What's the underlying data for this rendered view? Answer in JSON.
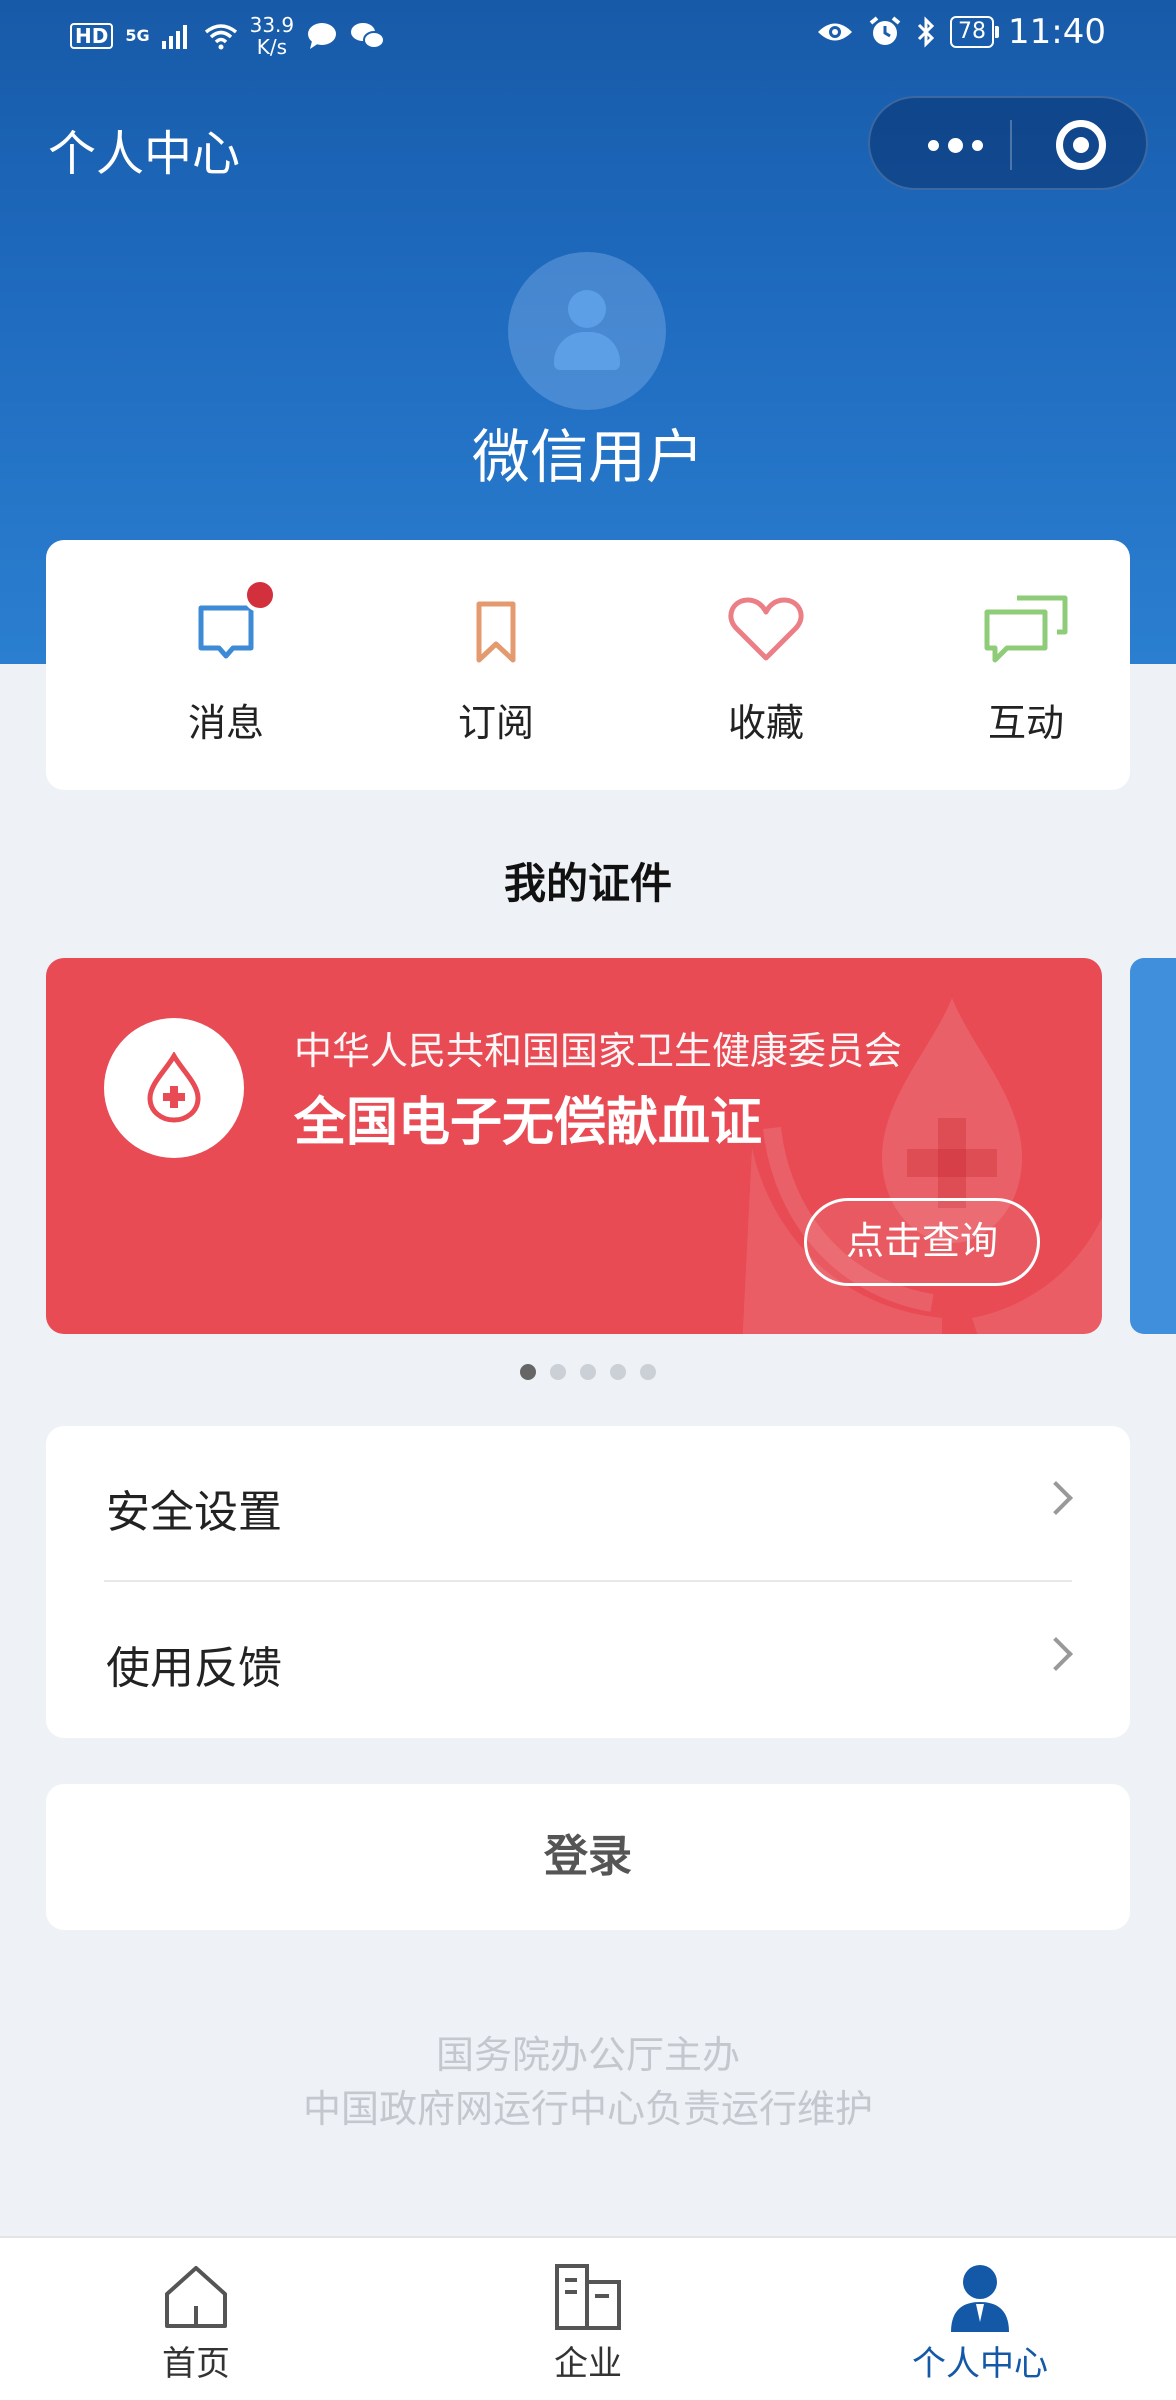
{
  "status_bar": {
    "hd": "HD",
    "network": "5G",
    "speed_value": "33.9",
    "speed_unit": "K/s",
    "battery": "78",
    "time": "11:40"
  },
  "nav": {
    "title": "个人中心"
  },
  "profile": {
    "username": "微信用户"
  },
  "quick_actions": [
    {
      "label": "消息",
      "icon": "message-icon",
      "has_badge": true
    },
    {
      "label": "订阅",
      "icon": "bookmark-icon"
    },
    {
      "label": "收藏",
      "icon": "heart-icon"
    },
    {
      "label": "互动",
      "icon": "chat-bubbles-icon"
    }
  ],
  "certificates": {
    "title": "我的证件",
    "card": {
      "org": "中华人民共和国国家卫生健康委员会",
      "name": "全国电子无偿献血证",
      "button": "点击查询",
      "color": "#e84b54"
    },
    "page_count": 5,
    "active_page": 1
  },
  "menu": [
    {
      "label": "安全设置"
    },
    {
      "label": "使用反馈"
    }
  ],
  "login": {
    "label": "登录"
  },
  "footer": {
    "line1": "国务院办公厅主办",
    "line2": "中国政府网运行中心负责运行维护"
  },
  "tabbar": [
    {
      "label": "首页",
      "icon": "home-icon"
    },
    {
      "label": "企业",
      "icon": "building-icon"
    },
    {
      "label": "个人中心",
      "icon": "person-icon",
      "active": true
    }
  ],
  "colors": {
    "brand_blue": "#1459a8",
    "badge_red": "#d3303d"
  }
}
